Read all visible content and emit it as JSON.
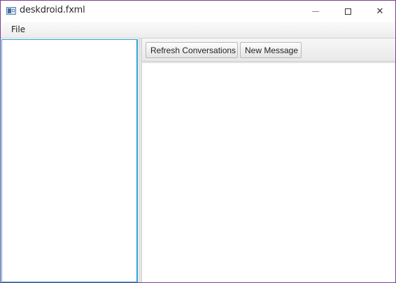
{
  "window": {
    "title": "deskdroid.fxml",
    "icon": "app-window-icon",
    "controls": {
      "minimize": "minimize-icon",
      "maximize": "maximize-icon",
      "close": "close-icon",
      "close_glyph": "✕"
    }
  },
  "menubar": {
    "items": [
      {
        "label": "File"
      }
    ]
  },
  "toolbar": {
    "refresh_label": "Refresh Conversations",
    "new_message_label": "New Message"
  },
  "colors": {
    "window_border": "#7b3f8f",
    "focus_border": "#2ea3d5"
  }
}
